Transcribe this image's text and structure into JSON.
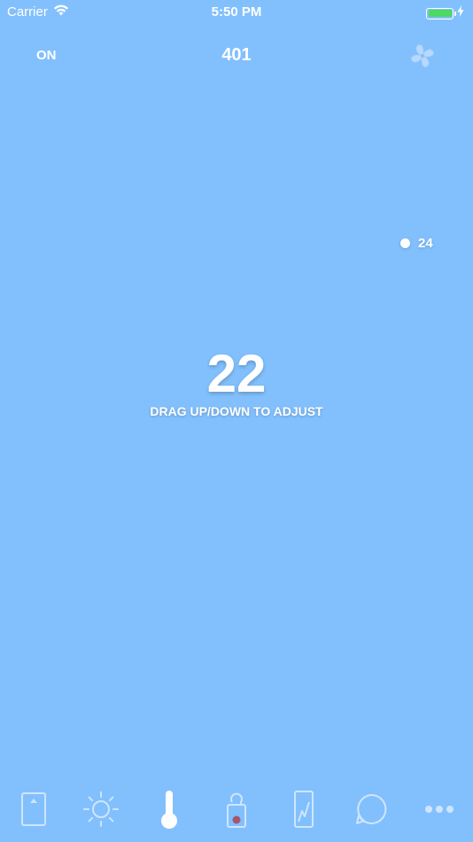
{
  "status_bar": {
    "carrier": "Carrier",
    "time": "5:50 PM",
    "battery_color": "#4cd964"
  },
  "header": {
    "power_label": "ON",
    "room_number": "401",
    "fan_icon": "fan-icon"
  },
  "setpoint": {
    "marker_value": "24"
  },
  "temperature": {
    "value": "22",
    "hint": "DRAG UP/DOWN TO ADJUST"
  },
  "tabs": [
    {
      "icon": "keycard-icon",
      "active": false
    },
    {
      "icon": "sun-icon",
      "active": false
    },
    {
      "icon": "thermometer-icon",
      "active": true
    },
    {
      "icon": "door-hanger-icon",
      "active": false
    },
    {
      "icon": "curtain-icon",
      "active": false
    },
    {
      "icon": "chat-bubble-icon",
      "active": false
    },
    {
      "icon": "more-icon",
      "active": false
    }
  ],
  "colors": {
    "background": "#82c0fd",
    "foreground": "#ffffff",
    "icon_inactive": "#cfe5fe",
    "dnd_dot": "#a5566f"
  }
}
